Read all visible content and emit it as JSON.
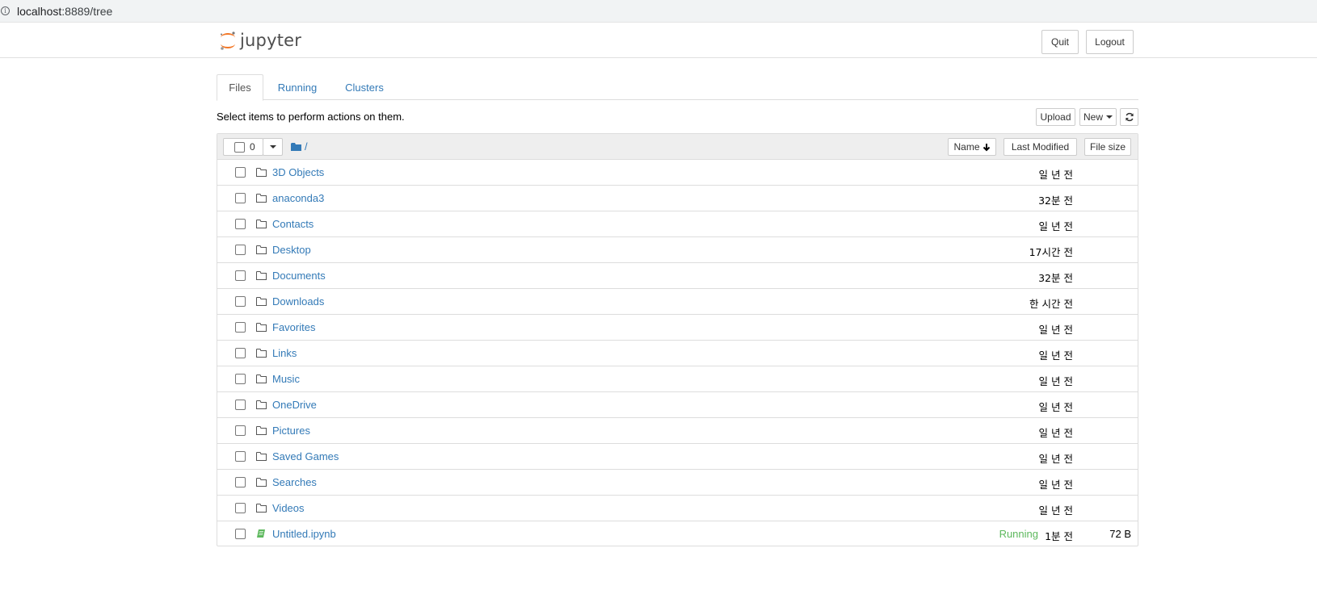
{
  "browser": {
    "url_host": "localhost",
    "url_rest": ":8889/tree"
  },
  "header": {
    "logo_text": "jupyter",
    "quit_label": "Quit",
    "logout_label": "Logout"
  },
  "tabs": [
    {
      "label": "Files",
      "active": true
    },
    {
      "label": "Running",
      "active": false
    },
    {
      "label": "Clusters",
      "active": false
    }
  ],
  "toolbar": {
    "select_text": "Select items to perform actions on them.",
    "upload_label": "Upload",
    "new_label": "New"
  },
  "list_header": {
    "selected_count": "0",
    "path": "/",
    "sort_name_label": "Name",
    "last_modified_label": "Last Modified",
    "file_size_label": "File size"
  },
  "items": [
    {
      "name": "3D Objects",
      "type": "folder",
      "modified": "일 년 전",
      "status": "",
      "size": ""
    },
    {
      "name": "anaconda3",
      "type": "folder",
      "modified": "32분 전",
      "status": "",
      "size": ""
    },
    {
      "name": "Contacts",
      "type": "folder",
      "modified": "일 년 전",
      "status": "",
      "size": ""
    },
    {
      "name": "Desktop",
      "type": "folder",
      "modified": "17시간 전",
      "status": "",
      "size": ""
    },
    {
      "name": "Documents",
      "type": "folder",
      "modified": "32분 전",
      "status": "",
      "size": ""
    },
    {
      "name": "Downloads",
      "type": "folder",
      "modified": "한 시간 전",
      "status": "",
      "size": ""
    },
    {
      "name": "Favorites",
      "type": "folder",
      "modified": "일 년 전",
      "status": "",
      "size": ""
    },
    {
      "name": "Links",
      "type": "folder",
      "modified": "일 년 전",
      "status": "",
      "size": ""
    },
    {
      "name": "Music",
      "type": "folder",
      "modified": "일 년 전",
      "status": "",
      "size": ""
    },
    {
      "name": "OneDrive",
      "type": "folder",
      "modified": "일 년 전",
      "status": "",
      "size": ""
    },
    {
      "name": "Pictures",
      "type": "folder",
      "modified": "일 년 전",
      "status": "",
      "size": ""
    },
    {
      "name": "Saved Games",
      "type": "folder",
      "modified": "일 년 전",
      "status": "",
      "size": ""
    },
    {
      "name": "Searches",
      "type": "folder",
      "modified": "일 년 전",
      "status": "",
      "size": ""
    },
    {
      "name": "Videos",
      "type": "folder",
      "modified": "일 년 전",
      "status": "",
      "size": ""
    },
    {
      "name": "Untitled.ipynb",
      "type": "notebook",
      "modified": "1분 전",
      "status": "Running",
      "size": "72 B"
    }
  ],
  "colors": {
    "link": "#337ab7",
    "running": "#5cb85c",
    "logo_orange": "#f37726"
  }
}
